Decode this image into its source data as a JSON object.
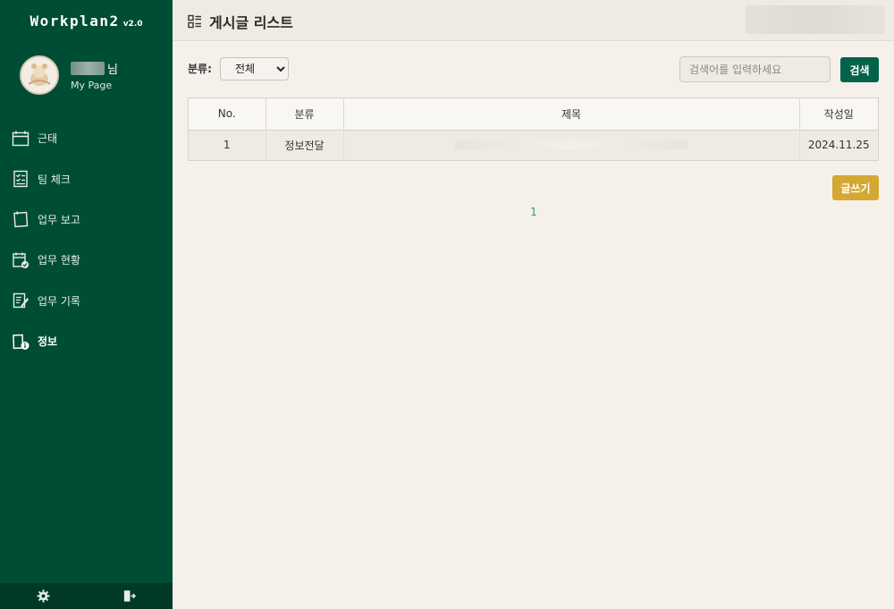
{
  "app": {
    "name": "Workplan2",
    "version": "v2.0"
  },
  "profile": {
    "suffix": "님",
    "mypage_label": "My Page"
  },
  "nav": [
    {
      "label": "근태",
      "icon": "calendar-icon",
      "active": false
    },
    {
      "label": "팀 체크",
      "icon": "checklist-icon",
      "active": false
    },
    {
      "label": "업무 보고",
      "icon": "note-icon",
      "active": false
    },
    {
      "label": "업무 현황",
      "icon": "calendar-check-icon",
      "active": false
    },
    {
      "label": "업무 기록",
      "icon": "edit-document-icon",
      "active": false
    },
    {
      "label": "정보",
      "icon": "info-book-icon",
      "active": true
    }
  ],
  "footer": {
    "settings_icon": "gear-icon",
    "logout_icon": "logout-icon"
  },
  "header": {
    "title": "게시글 리스트",
    "icon": "list-grid-icon"
  },
  "filter": {
    "label": "분류:",
    "selected": "전체"
  },
  "search": {
    "placeholder": "검색어를 입력하세요",
    "value": "",
    "button_label": "검색"
  },
  "table": {
    "columns": [
      "No.",
      "분류",
      "제목",
      "작성일"
    ],
    "rows": [
      {
        "no": "1",
        "category": "정보전달",
        "title": "",
        "date": "2024.11.25"
      }
    ]
  },
  "write_button_label": "글쓰기",
  "pagination": {
    "current": "1"
  },
  "colors": {
    "sidebar": "#004d35",
    "accent": "#00634a",
    "write": "#d4a833",
    "page_link": "#2a9d76"
  }
}
